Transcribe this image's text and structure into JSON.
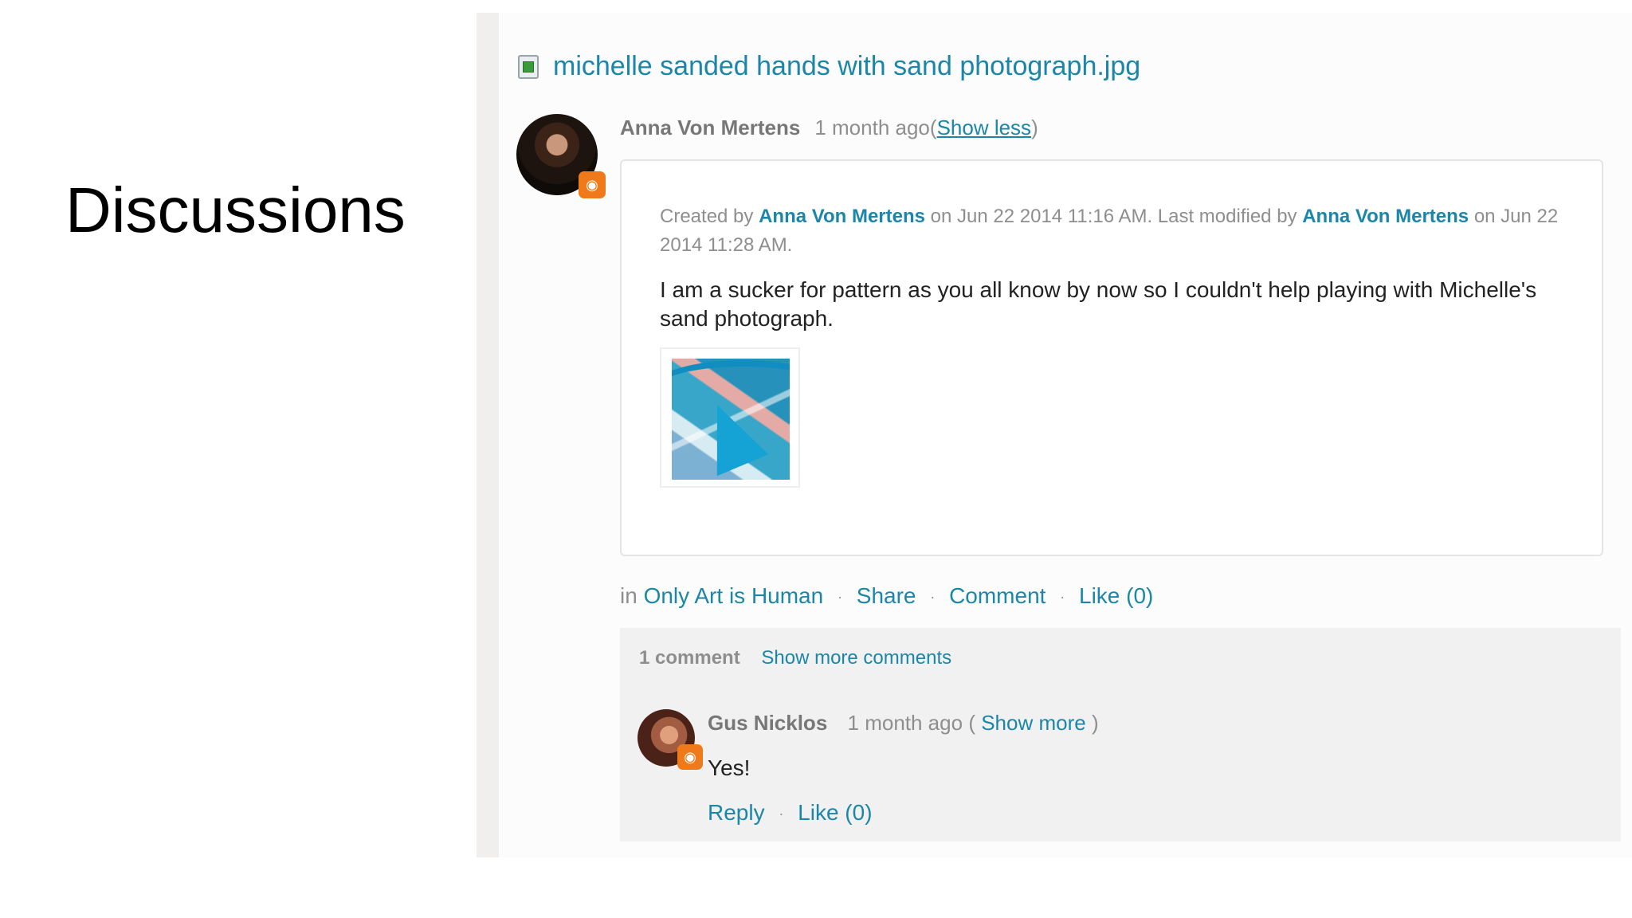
{
  "slide": {
    "title": "Discussions"
  },
  "file": {
    "icon": "image-file-icon",
    "title": "michelle sanded hands with sand photograph.jpg"
  },
  "post": {
    "author": "Anna Von Mertens",
    "time": "1 month ago",
    "open_paren": "(",
    "show_less": "Show less",
    "close_paren": ")",
    "created_by_prefix": "Created by",
    "created_by_name": "Anna Von Mertens",
    "created_middle": "on Jun 22 2014 11:16 AM. Last modified by",
    "modified_by_name": "Anna Von Mertens",
    "modified_suffix": "on Jun 22 2014 11:28 AM.",
    "body": "I am a sucker for pattern as you all know by now so I couldn't help playing with Michelle's sand photograph.",
    "avatar_badge_icon": "eye-icon"
  },
  "actions": {
    "in_label": "in",
    "group": "Only Art is Human",
    "separator": "·",
    "share": "Share",
    "comment": "Comment",
    "like": "Like (0)"
  },
  "comments": {
    "count": "1 comment",
    "show_more_comments": "Show more comments",
    "items": [
      {
        "author": "Gus Nicklos",
        "time": "1 month ago",
        "open_paren": "(",
        "show_more": "Show more",
        "close_paren": ")",
        "text": "Yes!",
        "reply": "Reply",
        "separator": "·",
        "like": "Like (0)",
        "avatar_badge_icon": "eye-icon"
      }
    ]
  },
  "colors": {
    "link": "#1b86a8",
    "muted_text": "#8e8e8e",
    "badge": "#f07a19",
    "comments_panel": "#f1f1f1"
  }
}
